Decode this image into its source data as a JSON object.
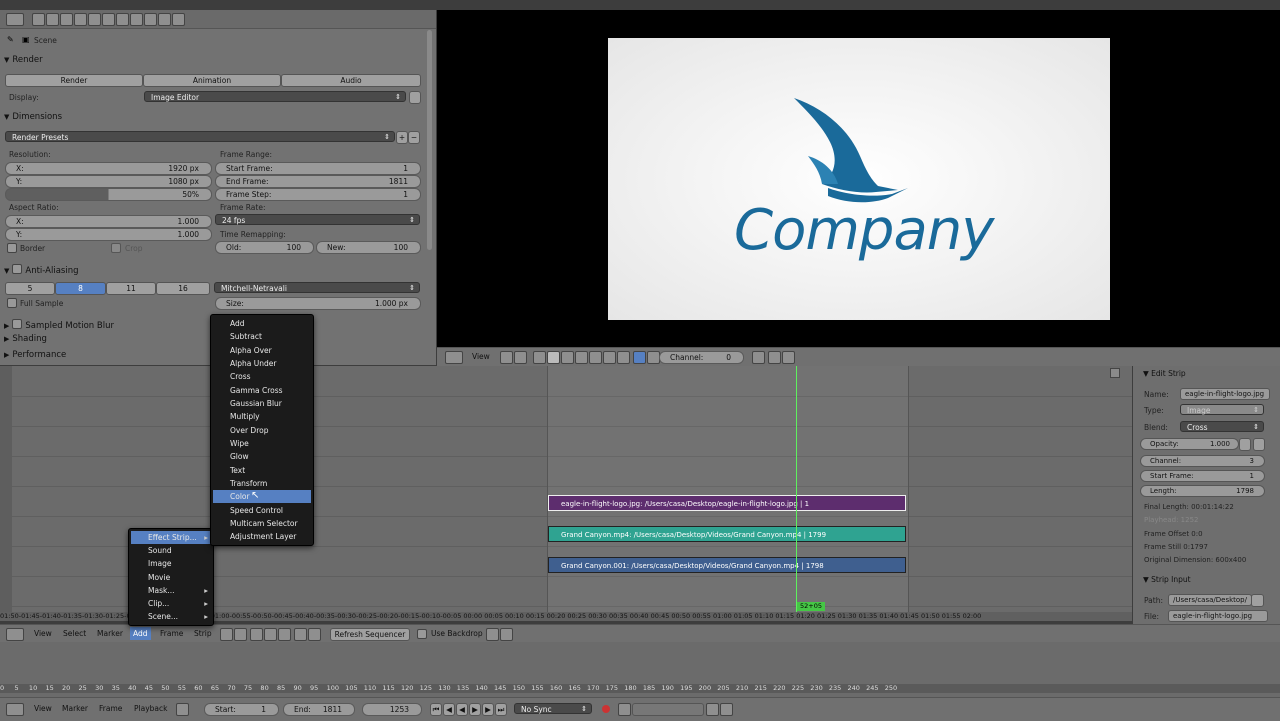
{
  "properties": {
    "scene_label": "Scene",
    "render": {
      "title": "Render",
      "buttons": [
        "Render",
        "Animation",
        "Audio"
      ],
      "display_label": "Display:",
      "display_value": "Image Editor"
    },
    "dimensions": {
      "title": "Dimensions",
      "presets": "Render Presets",
      "resolution_label": "Resolution:",
      "res_x_label": "X:",
      "res_x": "1920 px",
      "res_y_label": "Y:",
      "res_y": "1080 px",
      "res_pct": "50%",
      "frame_range_label": "Frame Range:",
      "start_label": "Start Frame:",
      "start": "1",
      "end_label": "End Frame:",
      "end": "1811",
      "step_label": "Frame Step:",
      "step": "1",
      "aspect_label": "Aspect Ratio:",
      "asp_x_label": "X:",
      "asp_x": "1.000",
      "asp_y_label": "Y:",
      "asp_y": "1.000",
      "frame_rate_label": "Frame Rate:",
      "frame_rate": "24 fps",
      "remap_label": "Time Remapping:",
      "old_label": "Old:",
      "old": "100",
      "new_label": "New:",
      "new": "100",
      "border_label": "Border",
      "crop_label": "Crop"
    },
    "aa": {
      "title": "Anti-Aliasing",
      "samples": [
        "5",
        "8",
        "11",
        "16"
      ],
      "filter": "Mitchell-Netravali",
      "full_sample": "Full Sample",
      "size_label": "Size:",
      "size": "1.000 px"
    },
    "collapsed": [
      "Sampled Motion Blur",
      "Shading",
      "Performance"
    ]
  },
  "preview": {
    "logo_text": "Company",
    "view_label": "View",
    "channel_label": "Channel:",
    "channel_value": "0"
  },
  "strips": [
    {
      "label": "eagle-in-flight-logo.jpg: /Users/casa/Desktop/eagle-in-flight-logo.jpg | 1",
      "color": "#5d2d6e"
    },
    {
      "label": "Grand Canyon.mp4: /Users/casa/Desktop/Videos/Grand Canyon.mp4 | 1799",
      "color": "#2fa391"
    },
    {
      "label": "Grand Canyon.001: /Users/casa/Desktop/Videos/Grand Canyon.mp4 | 1798",
      "color": "#3f5f8f"
    }
  ],
  "sequencer": {
    "frame_indicator": "52+05",
    "ruler": "01:50-01:45-01:40-01:35-01:30-01:25-01:20-01:15-01:10-01:05-01:00-00:55-00:50-00:45-00:40-00:35-00:30-00:25-00:20-00:15-00:10-00:05 00:00 00:05 00:10 00:15 00:20 00:25 00:30 00:35 00:40 00:45 00:50 00:55 01:00 01:05 01:10 01:15 01:20 01:25 01:30 01:35 01:40 01:45 01:50 01:55 02:00",
    "menus": [
      "View",
      "Select",
      "Marker",
      "Add",
      "Frame",
      "Strip"
    ],
    "refresh": "Refresh Sequencer",
    "use_backdrop": "Use Backdrop"
  },
  "add_menu": [
    "Effect Strip...",
    "Sound",
    "Image",
    "Movie",
    "Mask...",
    "Clip...",
    "Scene..."
  ],
  "effect_menu": [
    "Add",
    "Subtract",
    "Alpha Over",
    "Alpha Under",
    "Cross",
    "Gamma Cross",
    "Gaussian Blur",
    "Multiply",
    "Over Drop",
    "Wipe",
    "Glow",
    "Text",
    "Transform",
    "Color",
    "Speed Control",
    "Multicam Selector",
    "Adjustment Layer"
  ],
  "edit_strip": {
    "title": "Edit Strip",
    "name_label": "Name:",
    "name": "eagle-in-flight-logo.jpg",
    "type_label": "Type:",
    "type": "Image",
    "blend_label": "Blend:",
    "blend": "Cross",
    "opacity_label": "Opacity:",
    "opacity": "1.000",
    "channel_label": "Channel:",
    "channel": "3",
    "start_label": "Start Frame:",
    "start": "1",
    "length_label": "Length:",
    "length": "1798",
    "info": [
      "Final Length: 00:01:14:22",
      "Playhead: 1252",
      "Frame Offset 0:0",
      "Frame Still 0:1797",
      "Original Dimension: 600x400"
    ],
    "strip_input": "Strip Input",
    "path_label": "Path:",
    "path": "/Users/casa/Desktop/",
    "file_label": "File:",
    "file": "eagle-in-flight-logo.jpg"
  },
  "timeline": {
    "ruler": "0     5     10    15    20    25    30    35    40    45    50    55    60    65    70    75    80    85    90    95    100   105   110   115   120   125   130   135   140   145   150   155   160   165   170   175   180   185   190   195   200   205   210   215   220   225   230   235   240   245   250",
    "menus": [
      "View",
      "Marker",
      "Frame",
      "Playback"
    ],
    "start_label": "Start:",
    "start": "1",
    "end_label": "End:",
    "end": "1811",
    "current": "1253",
    "sync": "No Sync"
  }
}
